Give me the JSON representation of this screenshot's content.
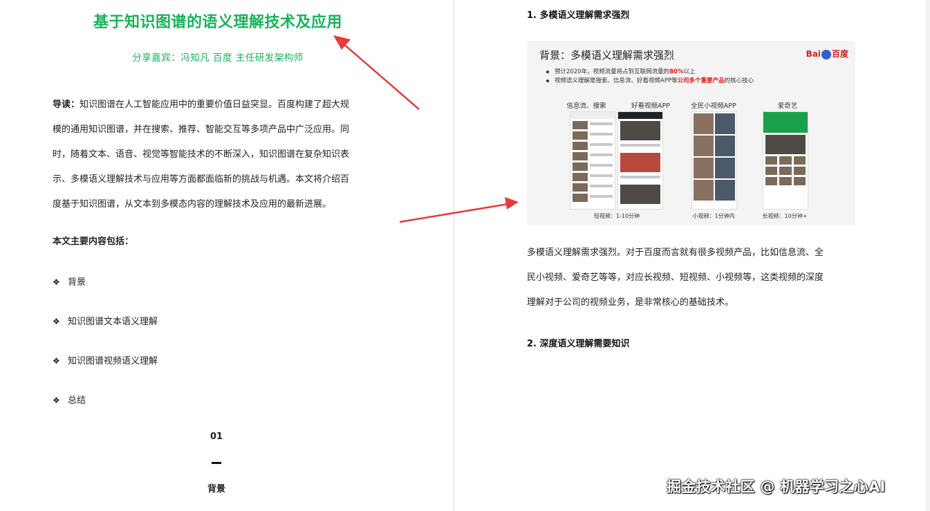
{
  "left": {
    "title": "基于知识图谱的语义理解技术及应用",
    "subtitle": "分享嘉宾：冯知凡 百度 主任研发架构师",
    "intro_label": "导读：",
    "intro_lines": [
      "知识图谱在人工智能应用中的重要价值日益突显。百度构建了超大规",
      "模的通用知识图谱，并在搜索、推荐、智能交互等多项产品中广泛应用。同",
      "时，随着文本、语音、视觉等智能技术的不断深入，知识图谱在复杂知识表",
      "示、多模语义理解技术与应用等方面都面临新的挑战与机遇。本文将介绍百",
      "度基于知识图谱，从文本到多模态内容的理解技术及应用的最新进展。"
    ],
    "toc_title": "本文主要内容包括：",
    "toc_bullet": "❖",
    "toc_items": [
      "背景",
      "知识图谱文本语义理解",
      "知识图谱视频语义理解",
      "总结"
    ],
    "section_number": "01",
    "section_name": "背景"
  },
  "right": {
    "heading1": "1. 多模语义理解需求强烈",
    "slide": {
      "title": "背景：多模语义理解需求强烈",
      "logo_text_a": "Bai",
      "logo_text_b": "百度",
      "bullet1_a": "预计2020年，视频流量将占到互联网流量的",
      "bullet1_red": "80%",
      "bullet1_b": "以上",
      "bullet2_a": "视频语义理解是搜索、信息流、好看视频APP等",
      "bullet2_red": "公司多个重要产品",
      "bullet2_b": "的核心技心",
      "categories": [
        "信息流、搜索",
        "好看视频APP",
        "全民小视频APP",
        "爱奇艺"
      ],
      "captions": [
        "短视频：1-10分钟",
        "小视频：1分钟内",
        "长视频：10分钟+"
      ]
    },
    "para_lines": [
      "多模语义理解需求强烈。对于百度而言就有很多视频产品，比如信息流、全",
      "民小视频、爱奇艺等等，对应长视频、短视频、小视频等，这类视频的深度",
      "理解对于公司的视频业务，是非常核心的基础技术。"
    ],
    "heading2": "2. 深度语义理解需要知识"
  },
  "watermark": "掘金技术社区 @ 机器学习之心AI",
  "colors": {
    "title_green": "#17b35a",
    "arrow_red": "#e83a3a",
    "emphasis_red": "#ee1111"
  }
}
